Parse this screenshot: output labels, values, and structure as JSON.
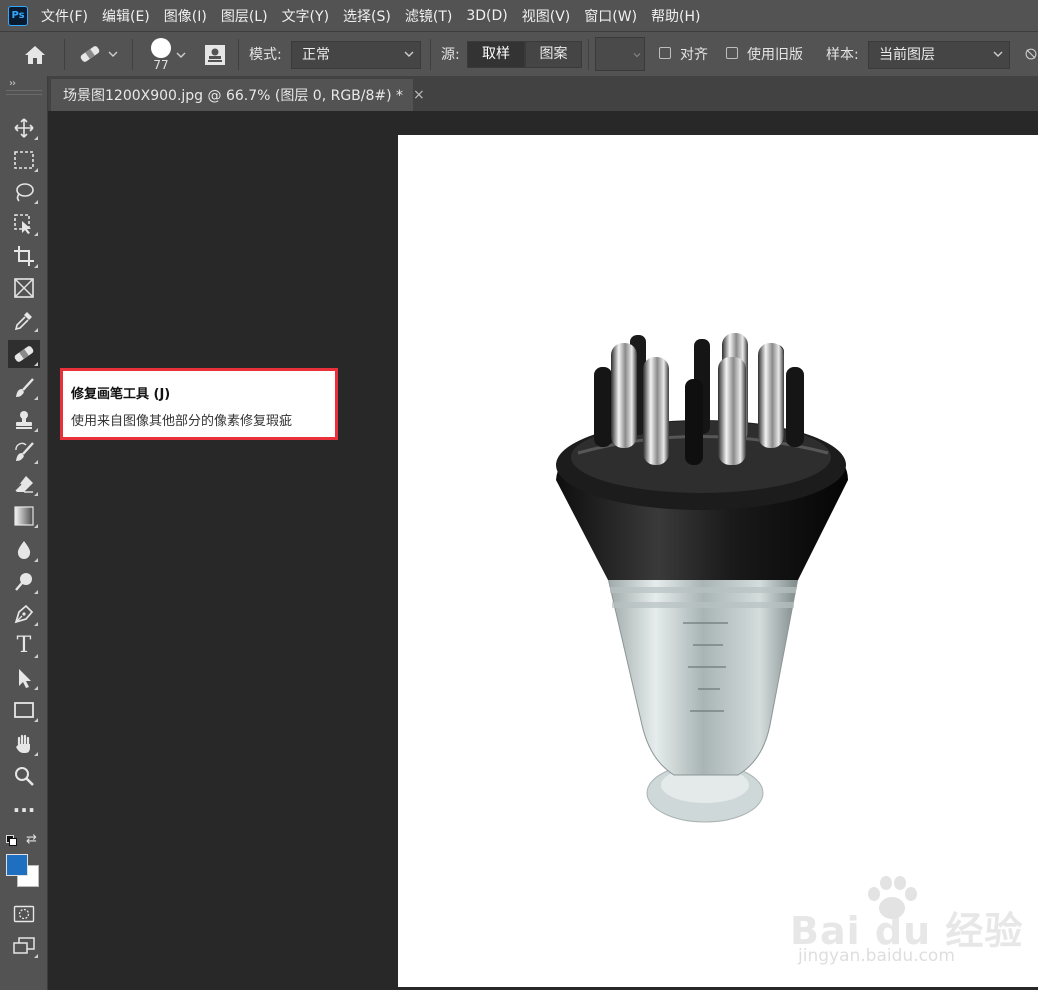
{
  "app": {
    "logo_text": "Ps"
  },
  "menubar": {
    "items": [
      "文件(F)",
      "编辑(E)",
      "图像(I)",
      "图层(L)",
      "文字(Y)",
      "选择(S)",
      "滤镜(T)",
      "3D(D)",
      "视图(V)",
      "窗口(W)",
      "帮助(H)"
    ]
  },
  "options": {
    "brush_size": "77",
    "mode_label": "模式:",
    "mode_value": "正常",
    "source_label": "源:",
    "source_sampled": "取样",
    "source_pattern": "图案",
    "aligned_label": "对齐",
    "aligned_checked": false,
    "legacy_label": "使用旧版",
    "legacy_checked": false,
    "sample_label": "样本:",
    "sample_value": "当前图层"
  },
  "tools": [
    {
      "name": "move-tool",
      "icon": "move-icon"
    },
    {
      "name": "marquee-tool",
      "icon": "rect-marquee-icon"
    },
    {
      "name": "lasso-tool",
      "icon": "lasso-icon"
    },
    {
      "name": "object-selection-tool",
      "icon": "object-select-icon"
    },
    {
      "name": "crop-tool",
      "icon": "crop-icon"
    },
    {
      "name": "frame-tool",
      "icon": "frame-icon"
    },
    {
      "name": "eyedropper-tool",
      "icon": "eyedropper-icon"
    },
    {
      "name": "healing-brush-tool",
      "icon": "bandage-icon",
      "active": true
    },
    {
      "name": "brush-tool",
      "icon": "brush-icon"
    },
    {
      "name": "clone-stamp-tool",
      "icon": "stamp-icon"
    },
    {
      "name": "history-brush-tool",
      "icon": "history-brush-icon"
    },
    {
      "name": "eraser-tool",
      "icon": "eraser-icon"
    },
    {
      "name": "gradient-tool",
      "icon": "gradient-icon"
    },
    {
      "name": "blur-tool",
      "icon": "drop-icon"
    },
    {
      "name": "dodge-tool",
      "icon": "dodge-icon"
    },
    {
      "name": "pen-tool",
      "icon": "pen-icon"
    },
    {
      "name": "type-tool",
      "icon": "type-icon",
      "glyph": "T"
    },
    {
      "name": "path-selection-tool",
      "icon": "arrow-icon"
    },
    {
      "name": "rectangle-tool",
      "icon": "rectangle-icon"
    },
    {
      "name": "hand-tool",
      "icon": "hand-icon"
    },
    {
      "name": "zoom-tool",
      "icon": "zoom-icon"
    },
    {
      "name": "more-tools",
      "icon": "ellipsis-icon",
      "glyph": "···"
    }
  ],
  "colors": {
    "foreground": "#1e6fc0",
    "background": "#ffffff",
    "tooltip_border": "#e8313a"
  },
  "document": {
    "tab_title": "场景图1200X900.jpg @ 66.7% (图层 0, RGB/8#) *",
    "close_glyph": "×"
  },
  "tooltip": {
    "title": "修复画笔工具 (J)",
    "description": "使用来自图像其他部分的像素修复瑕疵"
  },
  "watermark": {
    "brand": "Bai du 经验",
    "url": "jingyan.baidu.com"
  }
}
